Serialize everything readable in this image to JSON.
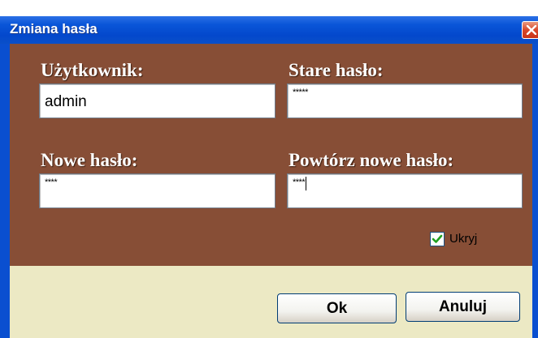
{
  "dialog": {
    "title": "Zmiana hasła"
  },
  "fields": {
    "user": {
      "label": "Użytkownik:",
      "value": "admin"
    },
    "old_password": {
      "label": "Stare hasło:",
      "value": "*****"
    },
    "new_password": {
      "label": "Nowe hasło:",
      "value": "****"
    },
    "repeat_password": {
      "label": "Powtórz nowe hasło:",
      "value": "****"
    }
  },
  "hide_checkbox": {
    "label": "Ukryj",
    "checked": true
  },
  "buttons": {
    "ok": "Ok",
    "cancel": "Anuluj"
  },
  "colors": {
    "title_bar": "#0a55d8",
    "form_background": "#874e36",
    "footer_background": "#ece9c4",
    "check_color": "#21a121"
  }
}
